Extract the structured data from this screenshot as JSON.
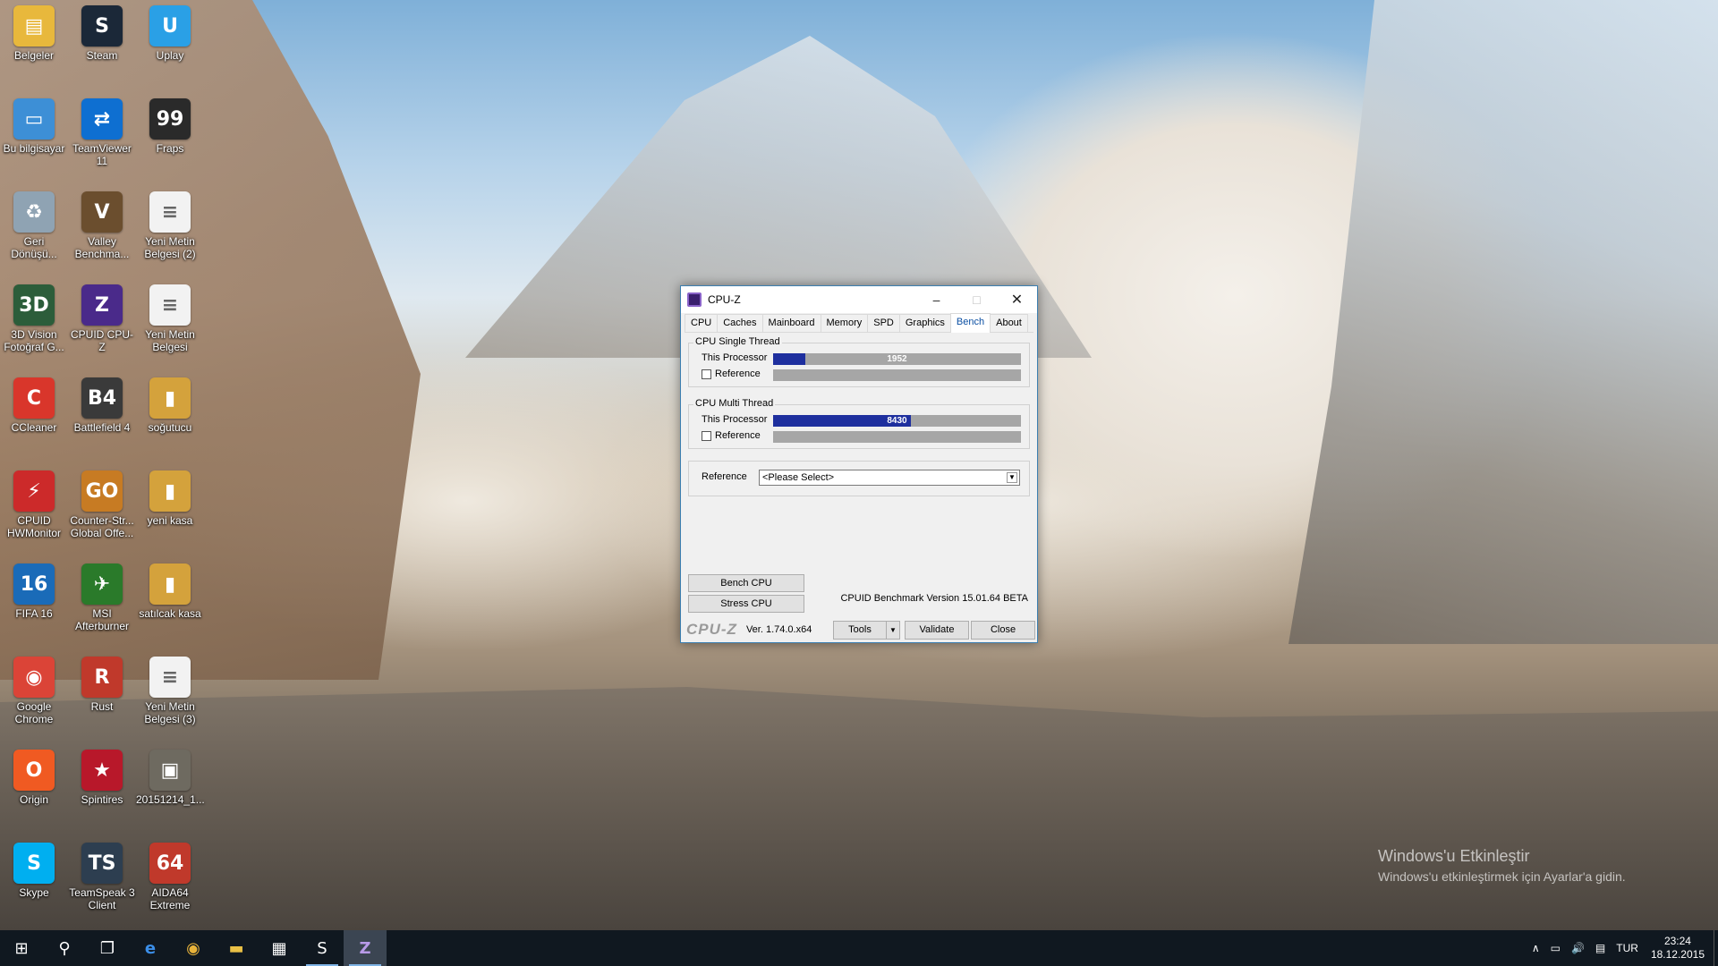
{
  "desktop": {
    "icons": [
      {
        "label": "Belgeler",
        "glyph": "▤",
        "color": "#e8b83c"
      },
      {
        "label": "Steam",
        "glyph": "S",
        "color": "#1b2838"
      },
      {
        "label": "Uplay",
        "glyph": "U",
        "color": "#2aa0e6"
      },
      {
        "label": "Bu bilgisayar",
        "glyph": "▭",
        "color": "#3d8fd6"
      },
      {
        "label": "TeamViewer 11",
        "glyph": "⇄",
        "color": "#0e6fd1"
      },
      {
        "label": "Fraps",
        "glyph": "99",
        "color": "#2a2a2a"
      },
      {
        "label": "Geri Dönüşü...",
        "glyph": "♻",
        "color": "#8fa3b3"
      },
      {
        "label": "Valley Benchma...",
        "glyph": "V",
        "color": "#6b4e2e"
      },
      {
        "label": "Yeni Metin Belgesi (2)",
        "glyph": "≡",
        "color": "#f2f2f2"
      },
      {
        "label": "3D Vision Fotoğraf G...",
        "glyph": "3D",
        "color": "#2c5d3a"
      },
      {
        "label": "CPUID CPU-Z",
        "glyph": "Z",
        "color": "#4a2a8a"
      },
      {
        "label": "Yeni Metin Belgesi",
        "glyph": "≡",
        "color": "#f2f2f2"
      },
      {
        "label": "CCleaner",
        "glyph": "C",
        "color": "#d9362b"
      },
      {
        "label": "Battlefield 4",
        "glyph": "B4",
        "color": "#3a3a3a"
      },
      {
        "label": "soğutucu",
        "glyph": "▮",
        "color": "#d4a23c"
      },
      {
        "label": "CPUID HWMonitor",
        "glyph": "⚡",
        "color": "#cc2a2a"
      },
      {
        "label": "Counter-Str... Global Offe...",
        "glyph": "GO",
        "color": "#c77b23"
      },
      {
        "label": "yeni kasa",
        "glyph": "▮",
        "color": "#d4a23c"
      },
      {
        "label": "FIFA 16",
        "glyph": "16",
        "color": "#1a6bb8"
      },
      {
        "label": "MSI Afterburner",
        "glyph": "✈",
        "color": "#2a7a2a"
      },
      {
        "label": "satılcak kasa",
        "glyph": "▮",
        "color": "#d4a23c"
      },
      {
        "label": "Google Chrome",
        "glyph": "◉",
        "color": "#db4437"
      },
      {
        "label": "Rust",
        "glyph": "R",
        "color": "#c0392b"
      },
      {
        "label": "Yeni Metin Belgesi (3)",
        "glyph": "≡",
        "color": "#f2f2f2"
      },
      {
        "label": "Origin",
        "glyph": "O",
        "color": "#f05a22"
      },
      {
        "label": "Spintires",
        "glyph": "★",
        "color": "#b8182a"
      },
      {
        "label": "20151214_1...",
        "glyph": "▣",
        "color": "#6e6a60"
      },
      {
        "label": "Skype",
        "glyph": "S",
        "color": "#00aff0"
      },
      {
        "label": "TeamSpeak 3 Client",
        "glyph": "TS",
        "color": "#2d3e50"
      },
      {
        "label": "AIDA64 Extreme",
        "glyph": "64",
        "color": "#c0392b"
      }
    ]
  },
  "window": {
    "title": "CPU-Z",
    "controls": {
      "minimize": "–",
      "maximize": "□",
      "close": "✕"
    },
    "tabs": [
      "CPU",
      "Caches",
      "Mainboard",
      "Memory",
      "SPD",
      "Graphics",
      "Bench",
      "About"
    ],
    "active_tab": "Bench",
    "single_thread": {
      "legend": "CPU Single Thread",
      "this_label": "This Processor",
      "this_value": "1952",
      "this_fill": 0.13,
      "ref_label": "Reference"
    },
    "multi_thread": {
      "legend": "CPU Multi Thread",
      "this_label": "This Processor",
      "this_value": "8430",
      "this_fill": 0.555,
      "ref_label": "Reference"
    },
    "reference": {
      "label": "Reference",
      "selected": "<Please Select>"
    },
    "buttons": {
      "bench_cpu": "Bench CPU",
      "stress_cpu": "Stress CPU"
    },
    "bench_version": "CPUID Benchmark Version 15.01.64 BETA",
    "footer": {
      "logo": "CPU-Z",
      "version": "Ver. 1.74.0.x64",
      "tools": "Tools",
      "validate": "Validate",
      "close": "Close"
    }
  },
  "watermark": {
    "title": "Windows'u Etkinleştir",
    "subtitle": "Windows'u etkinleştirmek için Ayarlar'a gidin."
  },
  "taskbar": {
    "items": [
      {
        "name": "start",
        "glyph": "⊞"
      },
      {
        "name": "search",
        "glyph": "⚲"
      },
      {
        "name": "task-view",
        "glyph": "❐"
      },
      {
        "name": "edge",
        "glyph": "e"
      },
      {
        "name": "chrome",
        "glyph": "◉"
      },
      {
        "name": "explorer",
        "glyph": "▬"
      },
      {
        "name": "store",
        "glyph": "▦"
      },
      {
        "name": "steam",
        "glyph": "S"
      },
      {
        "name": "cpu-z",
        "glyph": "Z"
      }
    ],
    "tray": {
      "chevron": "∧",
      "network": "▭",
      "volume": "🔊",
      "notifications": "▤",
      "language": "TUR",
      "time": "23:24",
      "date": "18.12.2015"
    }
  }
}
